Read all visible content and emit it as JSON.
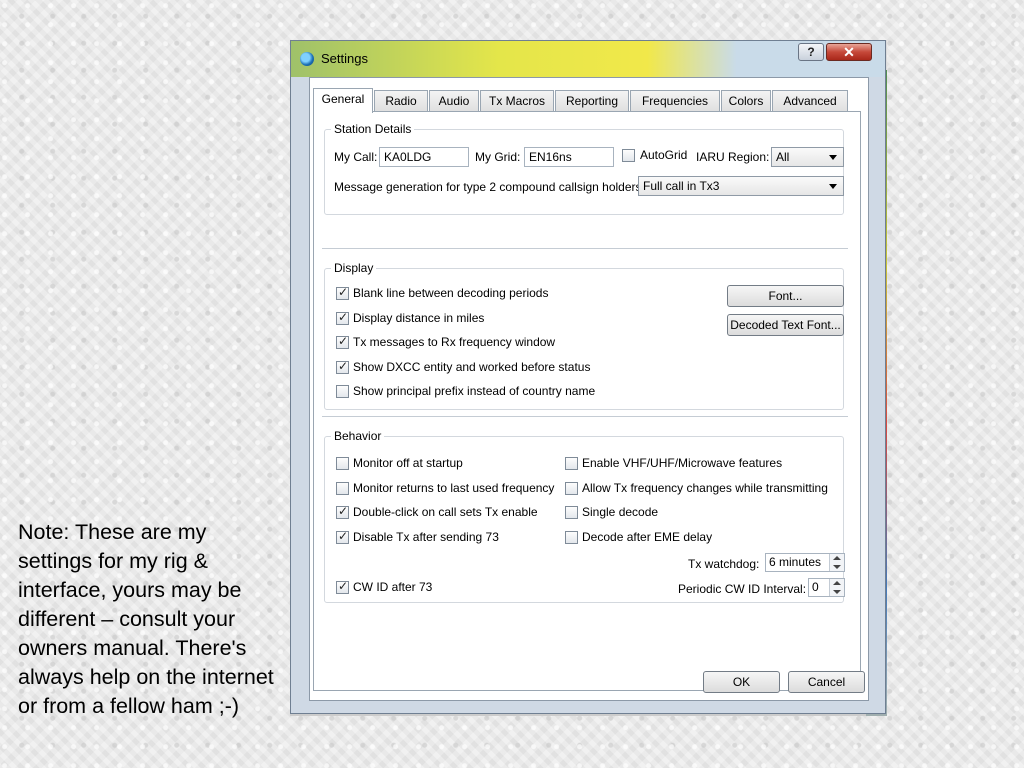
{
  "note": "Note:  These are my settings for my rig & interface, yours may be different – consult your owners manual.  There's always help on the internet or from a fellow ham ;-)",
  "window": {
    "title": "Settings",
    "help_label": "?",
    "close_label": "✕"
  },
  "tabs": [
    "General",
    "Radio",
    "Audio",
    "Tx Macros",
    "Reporting",
    "Frequencies",
    "Colors",
    "Advanced"
  ],
  "active_tab": "General",
  "station": {
    "title": "Station Details",
    "my_call_label": "My Call:",
    "my_call_value": "KA0LDG",
    "my_grid_label": "My Grid:",
    "my_grid_value": "EN16ns",
    "autogrid_label": "AutoGrid",
    "autogrid_checked": false,
    "iaru_label": "IARU Region:",
    "iaru_value": "All",
    "msg_gen_label": "Message generation for type 2 compound callsign holders:",
    "msg_gen_value": "Full call in Tx3"
  },
  "display": {
    "title": "Display",
    "options": [
      {
        "label": "Blank line between decoding periods",
        "checked": true
      },
      {
        "label": "Display distance in miles",
        "checked": true
      },
      {
        "label": "Tx messages to Rx frequency window",
        "checked": true
      },
      {
        "label": "Show DXCC entity and worked before status",
        "checked": true
      },
      {
        "label": "Show principal prefix instead of country name",
        "checked": false
      }
    ],
    "font_button": "Font...",
    "decoded_font_button": "Decoded Text Font..."
  },
  "behavior": {
    "title": "Behavior",
    "left": [
      {
        "label": "Monitor off at startup",
        "checked": false
      },
      {
        "label": "Monitor returns to last used frequency",
        "checked": false
      },
      {
        "label": "Double-click on call sets Tx enable",
        "checked": true
      },
      {
        "label": "Disable Tx after sending 73",
        "checked": true
      }
    ],
    "right": [
      {
        "label": "Enable VHF/UHF/Microwave features",
        "checked": false
      },
      {
        "label": "Allow Tx frequency changes while transmitting",
        "checked": false
      },
      {
        "label": "Single decode",
        "checked": false
      },
      {
        "label": "Decode after EME delay",
        "checked": false
      }
    ],
    "tx_watchdog_label": "Tx watchdog:",
    "tx_watchdog_value": "6 minutes",
    "cw_id_label": "CW ID after 73",
    "cw_id_checked": true,
    "periodic_cw_label": "Periodic CW ID Interval:",
    "periodic_cw_value": "0"
  },
  "buttons": {
    "ok": "OK",
    "cancel": "Cancel"
  }
}
